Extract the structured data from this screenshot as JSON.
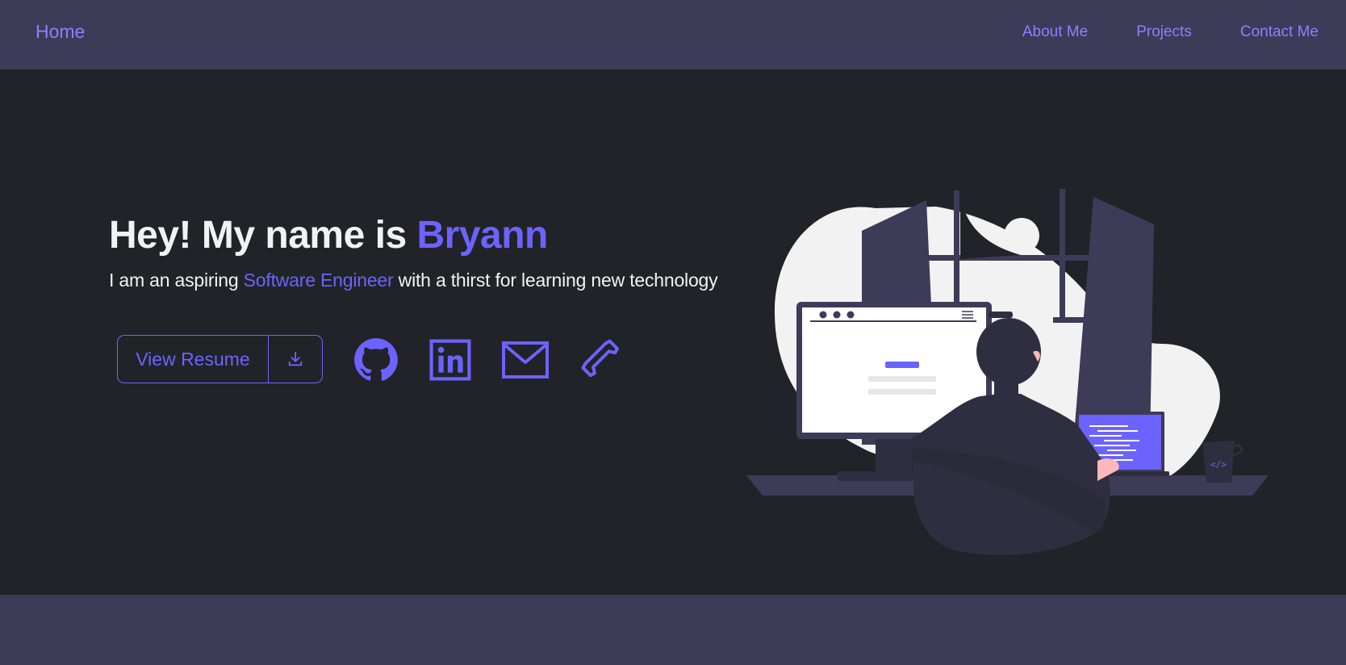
{
  "nav": {
    "home": "Home",
    "links": [
      "About Me",
      "Projects",
      "Contact Me"
    ]
  },
  "hero": {
    "title_prefix": "Hey! My name is ",
    "title_name": "Bryann",
    "subtitle_prefix": "I am an aspiring ",
    "subtitle_highlight": "Software Engineer",
    "subtitle_suffix": " with a thirst for learning new technology",
    "resume_label": "View Resume"
  },
  "icons": {
    "download": "download-icon",
    "social": [
      "github-icon",
      "linkedin-icon",
      "mail-icon",
      "phone-icon"
    ]
  },
  "colors": {
    "accent": "#6c63ff",
    "accent_light": "#8b80ff",
    "nav_bg": "#3e3b58",
    "page_bg": "#222328",
    "text": "#f2f2f2"
  }
}
